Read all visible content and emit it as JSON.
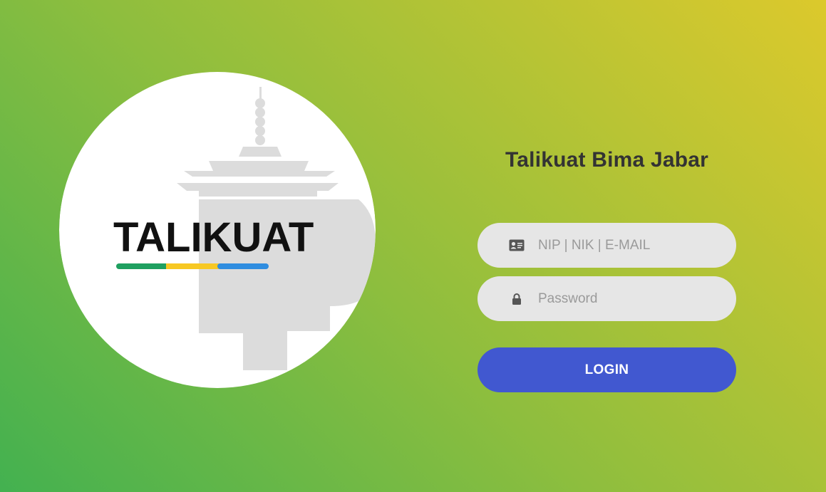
{
  "logo": {
    "wordmark": "TALIKUAT",
    "stripe_colors": [
      "#1fa060",
      "#f7c823",
      "#2f8de0"
    ]
  },
  "login": {
    "title": "Talikuat Bima Jabar",
    "username_placeholder": "NIP | NIK | E-MAIL",
    "username_icon": "id-card-icon",
    "password_placeholder": "Password",
    "password_icon": "lock-icon",
    "button_label": "LOGIN"
  },
  "colors": {
    "gradient_start": "#43b150",
    "gradient_end": "#dcc92c",
    "button": "#4158d0",
    "field_bg": "#e6e6e6",
    "title_text": "#333333"
  }
}
